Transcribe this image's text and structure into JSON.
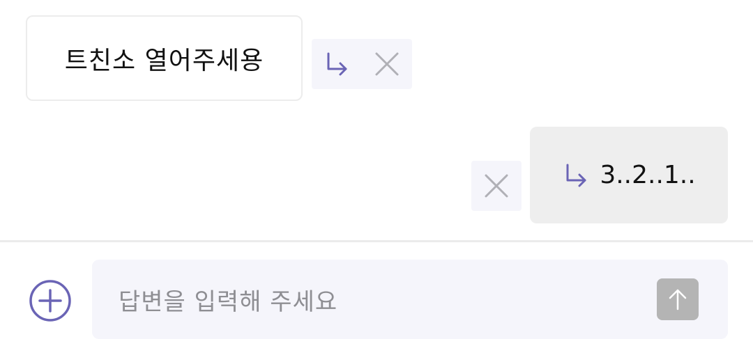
{
  "messages": {
    "incoming_text": "트친소 열어주세용",
    "reply_text": "3..2..1.."
  },
  "composer": {
    "placeholder": "답변을 입력해 주세요"
  },
  "icons": {
    "reply": "reply-arrow-icon",
    "close": "close-icon",
    "add": "plus-circle-icon",
    "send": "arrow-up-icon"
  },
  "colors": {
    "accent": "#6a64b5",
    "close_gray": "#b0b0b6",
    "send_disabled": "#b4b4b4"
  }
}
